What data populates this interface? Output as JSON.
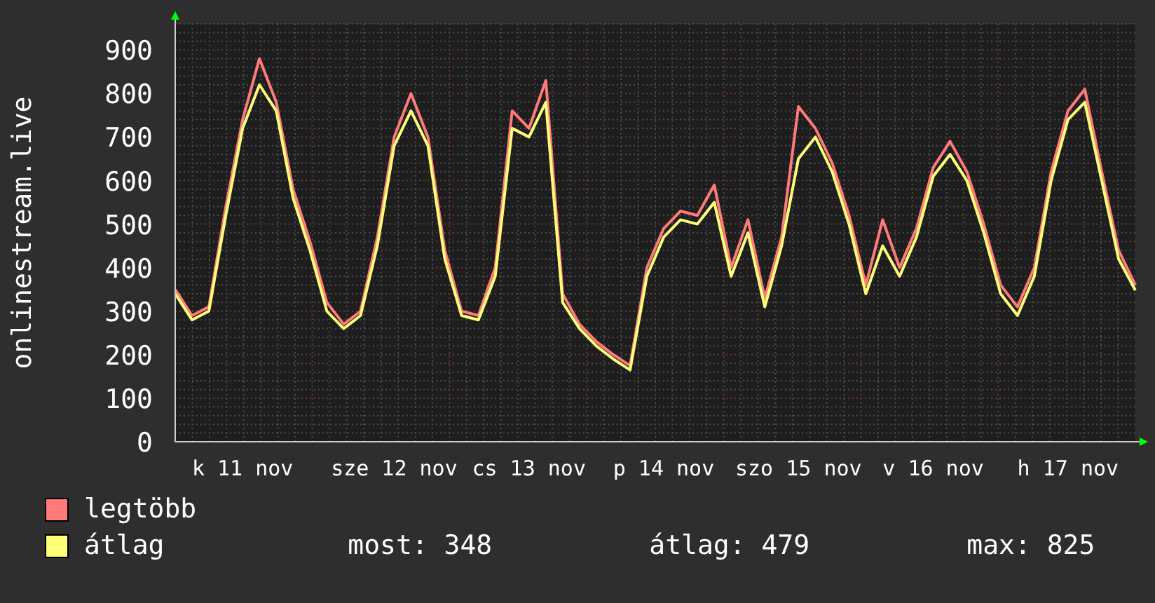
{
  "chart_data": {
    "type": "line",
    "grid": true,
    "ylabel": "onlinestream.live",
    "categories": [
      null,
      null,
      null,
      null,
      "k 11 nov",
      null,
      null,
      null,
      null,
      null,
      null,
      null,
      null,
      "sze 12 nov",
      null,
      null,
      null,
      null,
      null,
      null,
      null,
      "cs 13 nov",
      null,
      null,
      null,
      null,
      null,
      null,
      null,
      "p 14 nov",
      null,
      null,
      null,
      null,
      null,
      null,
      null,
      "szo 15 nov",
      null,
      null,
      null,
      null,
      null,
      null,
      null,
      "v 16 nov",
      null,
      null,
      null,
      null,
      null,
      null,
      null,
      "h 17 nov",
      null,
      null,
      null,
      null
    ],
    "series": [
      {
        "name": "legtöbb",
        "color": "#ff7a7a",
        "values": [
          350,
          290,
          310,
          540,
          740,
          880,
          780,
          580,
          460,
          320,
          270,
          300,
          470,
          700,
          800,
          700,
          440,
          300,
          290,
          400,
          760,
          720,
          830,
          340,
          270,
          230,
          200,
          175,
          400,
          490,
          530,
          520,
          590,
          400,
          510,
          330,
          470,
          770,
          720,
          640,
          520,
          360,
          510,
          400,
          490,
          630,
          690,
          620,
          500,
          360,
          310,
          400,
          620,
          760,
          810,
          620,
          440,
          360
        ]
      },
      {
        "name": "átlag",
        "color": "#ffff77",
        "values": [
          340,
          280,
          300,
          520,
          720,
          820,
          760,
          560,
          440,
          300,
          260,
          290,
          450,
          680,
          760,
          680,
          420,
          290,
          280,
          380,
          720,
          700,
          780,
          320,
          260,
          220,
          190,
          165,
          380,
          470,
          510,
          500,
          550,
          380,
          480,
          310,
          450,
          650,
          700,
          620,
          500,
          340,
          450,
          380,
          470,
          610,
          660,
          600,
          480,
          340,
          290,
          380,
          600,
          740,
          780,
          600,
          420,
          348
        ]
      }
    ],
    "ylim": [
      0,
      960
    ],
    "yticks": [
      0,
      100,
      200,
      300,
      400,
      500,
      600,
      700,
      800,
      900
    ]
  },
  "stats": [
    "most: 348",
    "átlag: 479",
    "max: 825"
  ]
}
